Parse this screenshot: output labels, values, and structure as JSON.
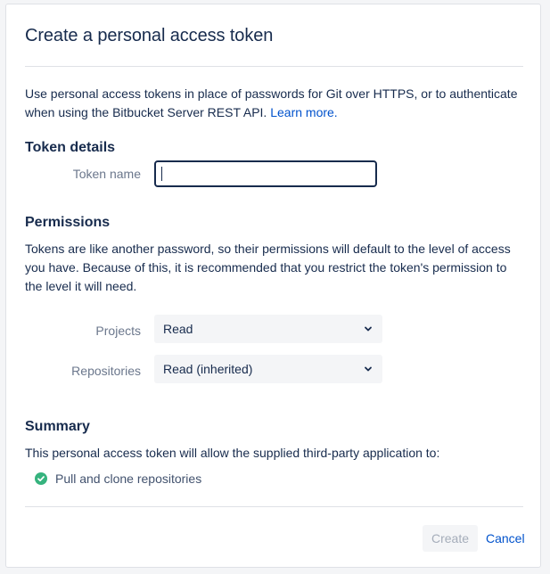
{
  "dialog": {
    "title": "Create a personal access token",
    "intro_text": "Use personal access tokens in place of passwords for Git over HTTPS, or to authenticate when using the Bitbucket Server REST API.",
    "learn_more_label": "Learn more."
  },
  "token_details": {
    "heading": "Token details",
    "name_label": "Token name",
    "name_value": "",
    "name_placeholder": ""
  },
  "permissions": {
    "heading": "Permissions",
    "description": "Tokens are like another password, so their permissions will default to the level of access you have. Because of this, it is recommended that you restrict the token's permission to the level it will need.",
    "projects_label": "Projects",
    "projects_value": "Read",
    "repositories_label": "Repositories",
    "repositories_value": "Read (inherited)"
  },
  "summary": {
    "heading": "Summary",
    "text": "This personal access token will allow the supplied third-party application to:",
    "items": [
      "Pull and clone repositories"
    ]
  },
  "actions": {
    "create_label": "Create",
    "cancel_label": "Cancel"
  },
  "icons": {
    "select_arrow": "chevron-down-icon",
    "summary_item": "check-circle-icon"
  },
  "colors": {
    "link": "#0052cc",
    "success": "#36b37e",
    "text": "#172b4d",
    "muted_label": "#6b778c",
    "disabled_text": "#a5adba"
  }
}
